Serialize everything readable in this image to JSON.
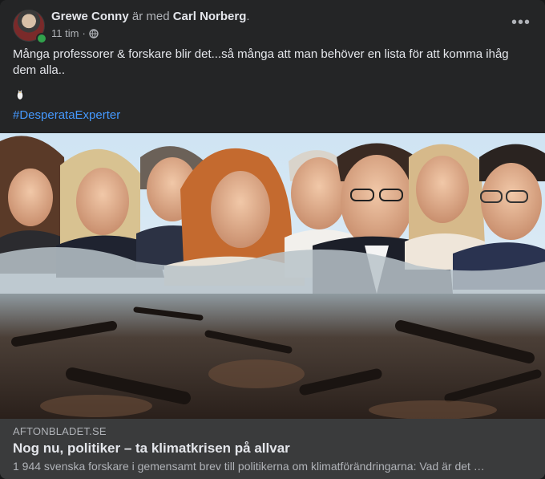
{
  "post": {
    "author": "Grewe Conny",
    "with_text": "är med",
    "with_person": "Carl Norberg",
    "period": ".",
    "time": "11 tim",
    "separator": "·",
    "privacy_icon": "globe-icon",
    "more_icon": "more-horizontal-icon",
    "text": "Många professorer & forskare blir det...så många att man behöver en lista för att komma ihåg dem alla..",
    "emoji_icon": "penguin-icon",
    "hashtag": "#DesperataExperter"
  },
  "link": {
    "domain": "AFTONBLADET.SE",
    "title": "Nog nu, politiker – ta klimatkrisen på allvar",
    "description": "1 944 svenska forskare i gemensamt brev till politikerna om klimatförändringarna: Vad är det …"
  },
  "colors": {
    "card_bg": "#242526",
    "text_primary": "#e4e6eb",
    "text_secondary": "#b0b3b8",
    "link_blue": "#4599ff",
    "preview_bg": "#3a3b3c",
    "online_green": "#31a24c"
  }
}
